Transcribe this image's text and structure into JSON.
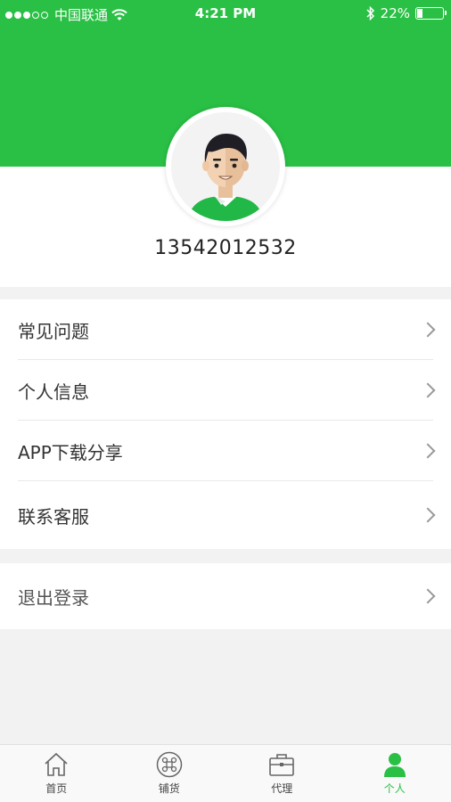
{
  "status_bar": {
    "carrier": "中国联通",
    "time": "4:21 PM",
    "battery_pct": "22%",
    "battery_level": 0.22
  },
  "profile": {
    "phone": "13542012532"
  },
  "menu": {
    "items": [
      {
        "label": "常见问题"
      },
      {
        "label": "个人信息"
      },
      {
        "label": "APP下载分享"
      },
      {
        "label": "联系客服"
      }
    ],
    "logout": {
      "label": "退出登录"
    }
  },
  "tabbar": {
    "tabs": [
      {
        "label": "首页",
        "icon": "home-icon"
      },
      {
        "label": "铺货",
        "icon": "command-icon"
      },
      {
        "label": "代理",
        "icon": "briefcase-icon"
      },
      {
        "label": "个人",
        "icon": "person-icon"
      }
    ],
    "active_color": "#2ac045"
  },
  "colors": {
    "brand": "#2ac045"
  }
}
